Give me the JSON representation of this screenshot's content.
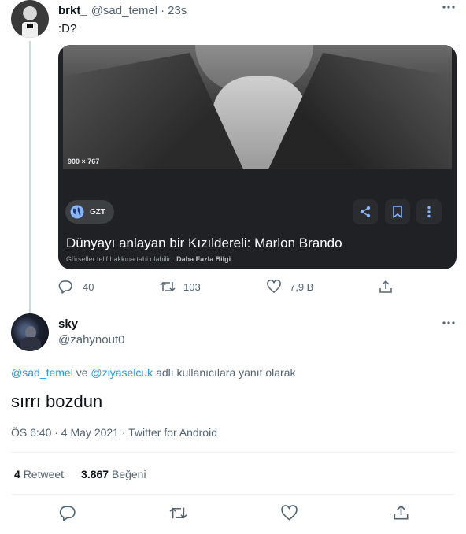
{
  "reply_tweet": {
    "display_name": "brkt_",
    "handle": "@sad_temel",
    "separator": "·",
    "time": "23s",
    "text": ":D?",
    "card": {
      "image_size": "900 × 767",
      "source_badge": "GZT",
      "title": "Dünyayı anlayan bir Kızıldereli: Marlon Brando",
      "copyright_note": "Görseller telif hakkına tabi olabilir.",
      "more_info": "Daha Fazla Bilgi"
    },
    "actions": {
      "replies": "40",
      "retweets": "103",
      "likes": "7,9 B"
    }
  },
  "main_tweet": {
    "display_name": "sky",
    "handle": "@zahynout0",
    "reply_to_mention_1": "@sad_temel",
    "reply_to_conj": " ve ",
    "reply_to_mention_2": "@ziyaselcuk",
    "reply_to_suffix": " adlı kullanıcılara yanıt olarak",
    "text": "sırrı bozdun",
    "timestamp": "ÖS 6:40 · 4 May 2021 · Twitter for Android",
    "stats": {
      "retweets_count": "4",
      "retweets_label": "Retweet",
      "likes_count": "3.867",
      "likes_label": "Beğeni"
    }
  },
  "colors": {
    "accent": "#1d9bf0",
    "muted": "#536471",
    "card_bg": "#202124"
  },
  "icons": [
    "more-icon",
    "reply-icon",
    "retweet-icon",
    "like-icon",
    "share-icon",
    "globe-icon",
    "bookmark-icon",
    "vertical-more-icon"
  ]
}
